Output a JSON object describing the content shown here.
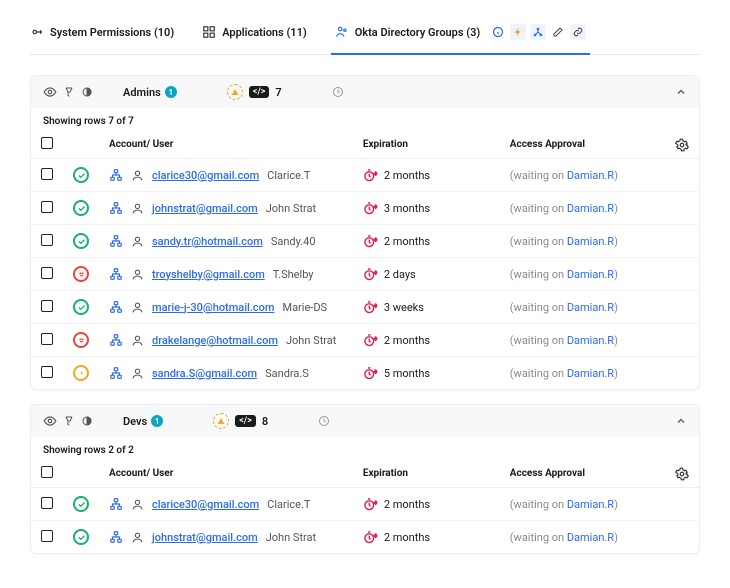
{
  "tabs": [
    {
      "label": "System Permissions (10)"
    },
    {
      "label": "Applications (11)"
    },
    {
      "label": "Okta Directory Groups (3)",
      "active": true
    }
  ],
  "groups": [
    {
      "name": "Admins",
      "badge_count": "1",
      "code_count": "7",
      "rows_caption": "Showing rows 7 of 7",
      "rows": [
        {
          "status": "ok",
          "email": "clarice30@gmail.com",
          "user": "Clarice.T",
          "exp": "2 months",
          "approver": "Damian.R"
        },
        {
          "status": "ok",
          "email": "johnstrat@gmail.com",
          "user": "John Strat",
          "exp": "3 months",
          "approver": "Damian.R"
        },
        {
          "status": "ok",
          "email": "sandy.tr@hotmail.com",
          "user": "Sandy.40",
          "exp": "2 months",
          "approver": "Damian.R"
        },
        {
          "status": "warn",
          "email": "troyshelby@gmail.com",
          "user": "T.Shelby",
          "exp": "2 days",
          "approver": "Damian.R"
        },
        {
          "status": "ok",
          "email": "marie-j-30@hotmail.com",
          "user": "Marie-DS",
          "exp": "3 weeks",
          "approver": "Damian.R"
        },
        {
          "status": "warn",
          "email": "drakelange@hotmail.com",
          "user": "John Strat",
          "exp": "2 months",
          "approver": "Damian.R"
        },
        {
          "status": "pending",
          "email": "sandra.S@gmail.com",
          "user": "Sandra.S",
          "exp": "5 months",
          "approver": "Damian.R"
        }
      ]
    },
    {
      "name": "Devs",
      "badge_count": "1",
      "code_count": "8",
      "rows_caption": "Showing rows 2 of 2",
      "rows": [
        {
          "status": "ok",
          "email": "clarice30@gmail.com",
          "user": "Clarice.T",
          "exp": "2 months",
          "approver": "Damian.R"
        },
        {
          "status": "ok",
          "email": "johnstrat@gmail.com",
          "user": "John Strat",
          "exp": "2 months",
          "approver": "Damian.R"
        }
      ]
    }
  ],
  "headers": {
    "account": "Account/ User",
    "expiration": "Expiration",
    "approval": "Access Approval"
  },
  "approval_prefix": "(waiting on ",
  "approval_suffix": ")"
}
